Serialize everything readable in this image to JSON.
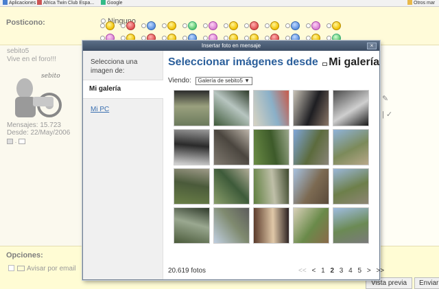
{
  "bookmarks": [
    {
      "label": "Aplicaciones",
      "color": "#4a7fd0"
    },
    {
      "label": "Africa Twin Club Espa...",
      "color": "#c55"
    },
    {
      "label": "Google",
      "color": "#3b8"
    },
    {
      "label": "Otros mar",
      "color": "#e8b84a"
    }
  ],
  "forum": {
    "posticono_label": "Posticono:",
    "ninguno_label": "Ninguno",
    "user": {
      "name": "sebito5",
      "title": "Vive en el foro!!!",
      "avatar_caption": "sebito",
      "messages": "Mensajes: 15.723",
      "since": "Desde: 22/May/2006"
    },
    "options_label": "Opciones:",
    "notify_label": "Avisar por email",
    "preview_button": "Vista previa",
    "send_button": "Enviar"
  },
  "modal": {
    "title": "Insertar foto en mensaje",
    "close_glyph": "×",
    "side": {
      "prompt": "Selecciona una imagen de:",
      "active_item": "Mi galería",
      "other_item": "Mi PC"
    },
    "main_title": "Seleccionar imágenes desde",
    "main_title_gallery": "Mi galería",
    "viewing_label": "Viendo:",
    "viewing_value": "Galería de sebito5",
    "photo_count": "20.619 fotos",
    "pager": {
      "first": "<<",
      "prev": "<",
      "pages": [
        "1",
        "2",
        "3",
        "4",
        "5"
      ],
      "current": "2",
      "next": ">",
      "last": ">>"
    },
    "photos": [
      {
        "name": "photo-moto-road",
        "colors": [
          "#6b7a5c",
          "#9aa07e",
          "#2c2c2c"
        ]
      },
      {
        "name": "photo-waterfall",
        "colors": [
          "#3f5a3a",
          "#b7c5c0",
          "#2e3b2a"
        ]
      },
      {
        "name": "photo-map",
        "colors": [
          "#d7d3c2",
          "#8ab0c8",
          "#c85a4a"
        ]
      },
      {
        "name": "photo-two-riders",
        "colors": [
          "#c8c2b6",
          "#1e1e22",
          "#8a7768"
        ]
      },
      {
        "name": "photo-moto-closeup",
        "colors": [
          "#4a4a4a",
          "#cfcfcf",
          "#1a1a1a"
        ]
      },
      {
        "name": "photo-moto-wheel",
        "colors": [
          "#d8d8d8",
          "#2a2a2a",
          "#9a9a9a"
        ]
      },
      {
        "name": "photo-stone-building",
        "colors": [
          "#807a70",
          "#4b463f",
          "#bbb3a8"
        ]
      },
      {
        "name": "photo-forest-road",
        "colors": [
          "#6b8c45",
          "#3d5a2a",
          "#9aa68a"
        ]
      },
      {
        "name": "photo-open-road",
        "colors": [
          "#7fa6d9",
          "#5c6b3d",
          "#8a8478"
        ]
      },
      {
        "name": "photo-mountain-valley",
        "colors": [
          "#8fb3d9",
          "#7c8a5a",
          "#b8a88a"
        ]
      },
      {
        "name": "photo-riverbank",
        "colors": [
          "#6a7f47",
          "#4a5a3a",
          "#9e9a88"
        ]
      },
      {
        "name": "photo-bridge",
        "colors": [
          "#8a9e6a",
          "#3e5b3a",
          "#b0ab96"
        ]
      },
      {
        "name": "photo-stream",
        "colors": [
          "#5f7f3f",
          "#bfbfa8",
          "#3f4a2e"
        ]
      },
      {
        "name": "photo-bare-trees",
        "colors": [
          "#a6c1e0",
          "#7c6a52",
          "#5a4a3a"
        ]
      },
      {
        "name": "photo-winding-road",
        "colors": [
          "#9ab7d8",
          "#6d7f4a",
          "#8d8574"
        ]
      },
      {
        "name": "photo-rocky-stream",
        "colors": [
          "#4a5a3a",
          "#9aa890",
          "#2f3a2a"
        ]
      },
      {
        "name": "photo-country-road",
        "colors": [
          "#c0cfe0",
          "#7f8a6f",
          "#5c5c5c"
        ]
      },
      {
        "name": "photo-rider-portrait",
        "colors": [
          "#5a3a2a",
          "#e0c8a8",
          "#2a2020"
        ]
      },
      {
        "name": "photo-house-trees",
        "colors": [
          "#d8d0b8",
          "#6a8a4a",
          "#8a6a4a"
        ]
      },
      {
        "name": "photo-distant-rider",
        "colors": [
          "#9fbce0",
          "#6b8a54",
          "#7a7a7a"
        ]
      }
    ]
  },
  "colors": {
    "accent_title": "#2b5f9b",
    "link": "#3a6fb0",
    "modal_header": "#4a5b73",
    "forum_bg": "#fffbd9"
  }
}
